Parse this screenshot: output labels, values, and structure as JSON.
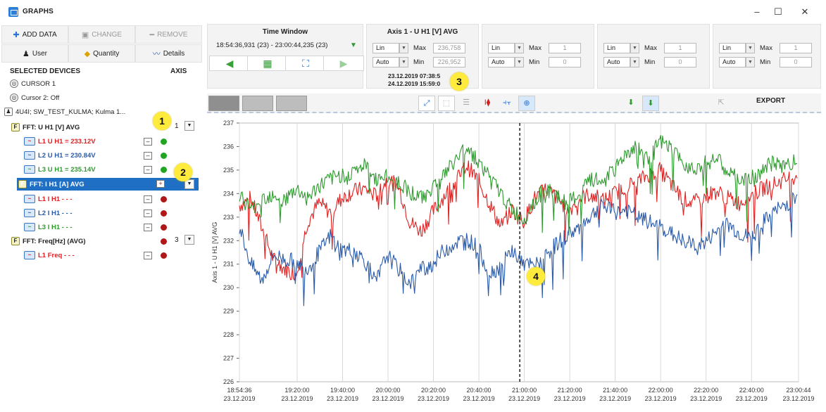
{
  "window": {
    "title": "GRAPHS",
    "minimize": "–",
    "maximize": "☐",
    "close": "✕"
  },
  "left_toolbar": {
    "add_data": "ADD DATA",
    "change": "CHANGE",
    "remove": "REMOVE",
    "user": "User",
    "quantity": "Quantity",
    "details": "Details"
  },
  "devices": {
    "header": "SELECTED DEVICES",
    "axis_header": "AXIS",
    "cursor1": "CURSOR 1",
    "cursor2": "Cursor 2: Off",
    "device": "4U4I; SW_TEST_KULMA; Kulma 1...",
    "fft_u": "FFT: U H1 [V] AVG",
    "l1_u": "L1 U H1 = 233.12V",
    "l2_u": "L2 U H1 = 230.84V",
    "l3_u": "L3 U H1 = 235.14V",
    "fft_i": "FFT: I H1 [A] AVG",
    "l1_i": "L1 I H1 - - -",
    "l2_i": "L2 I H1 - - -",
    "l3_i": "L3 I H1 - - -",
    "fft_f": "FFT: Freq[Hz] (AVG)",
    "l1_f": "L1 Freq - - -",
    "axis_u": "1",
    "axis_f": "3"
  },
  "colors": {
    "l1": "#e02020",
    "l2": "#2a5aa8",
    "l3": "#2e9a2e",
    "dot_green": "#1fa51f",
    "dot_red": "#b01818",
    "badge": "#ffeb3b"
  },
  "time_window": {
    "title": "Time Window",
    "range": "18:54:36,931 (23) - 23:00:44,235 (23)"
  },
  "axis1": {
    "title": "Axis 1 - U H1 [V] AVG",
    "scale": "Lin",
    "mode": "Auto",
    "max_label": "Max",
    "min_label": "Min",
    "max_value": "236,758",
    "min_value": "226,952",
    "date1": "23.12.2019 07:38:5",
    "date2": "24.12.2019 15:59:0"
  },
  "axis_panels": [
    {
      "scale": "Lin",
      "mode": "Auto",
      "max_label": "Max",
      "min_label": "Min",
      "max_value": "1",
      "min_value": "0"
    },
    {
      "scale": "Lin",
      "mode": "Auto",
      "max_label": "Max",
      "min_label": "Min",
      "max_value": "1",
      "min_value": "0"
    },
    {
      "scale": "Lin",
      "mode": "Auto",
      "max_label": "Max",
      "min_label": "Min",
      "max_value": "1",
      "min_value": "0"
    }
  ],
  "toolbar2": {
    "export": "EXPORT"
  },
  "badges": {
    "b1": "1",
    "b2": "2",
    "b3": "3",
    "b4": "4"
  },
  "chart_data": {
    "type": "line",
    "ylabel": "Axis 1 - U H1 [V] AVG",
    "ylim": [
      226,
      237
    ],
    "yticks": [
      "237",
      "236",
      "235",
      "234",
      "233",
      "232",
      "231",
      "230",
      "229",
      "228",
      "227",
      "226"
    ],
    "xticks": [
      {
        "time": "18:54:36",
        "date": "23.12.2019"
      },
      {
        "time": "19:20:00",
        "date": "23.12.2019"
      },
      {
        "time": "19:40:00",
        "date": "23.12.2019"
      },
      {
        "time": "20:00:00",
        "date": "23.12.2019"
      },
      {
        "time": "20:20:00",
        "date": "23.12.2019"
      },
      {
        "time": "20:40:00",
        "date": "23.12.2019"
      },
      {
        "time": "21:00:00",
        "date": "23.12.2019"
      },
      {
        "time": "21:20:00",
        "date": "23.12.2019"
      },
      {
        "time": "21:40:00",
        "date": "23.12.2019"
      },
      {
        "time": "22:00:00",
        "date": "23.12.2019"
      },
      {
        "time": "22:20:00",
        "date": "23.12.2019"
      },
      {
        "time": "22:40:00",
        "date": "23.12.2019"
      },
      {
        "time": "23:00:44",
        "date": "23.12.2019"
      }
    ],
    "x_minutes": [
      0,
      25.4,
      45.4,
      65.4,
      85.4,
      105.4,
      125.4,
      145.4,
      165.4,
      185.4,
      205.4,
      225.4,
      246.1
    ],
    "cursor_time": "20:58:00",
    "series": [
      {
        "name": "L1 U H1",
        "color": "#e02020",
        "x": [
          0,
          5,
          10,
          15,
          20,
          25,
          30,
          35,
          40,
          45,
          50,
          55,
          60,
          65,
          70,
          75,
          80,
          85,
          90,
          95,
          100,
          105,
          110,
          115,
          120,
          125,
          130,
          135,
          140,
          145,
          150,
          155,
          160,
          165,
          170,
          175,
          180,
          185,
          190,
          195,
          200,
          205,
          210,
          215,
          220,
          225,
          230,
          235,
          240,
          246
        ],
        "y": [
          233.5,
          233.8,
          232.5,
          231.2,
          230.8,
          230.6,
          232.8,
          233.6,
          233.2,
          233.8,
          234.1,
          234.2,
          233.9,
          234.6,
          234.3,
          232.8,
          232.4,
          233.2,
          233.9,
          234.5,
          235.2,
          234.6,
          233.6,
          232.6,
          233.3,
          232.8,
          233.8,
          234.2,
          233.8,
          233.3,
          233.8,
          234.0,
          233.7,
          234.0,
          234.3,
          234.5,
          234.8,
          235.0,
          234.4,
          233.8,
          233.6,
          233.9,
          234.1,
          233.8,
          233.6,
          233.9,
          234.2,
          234.4,
          234.6,
          234.8
        ]
      },
      {
        "name": "L2 U H1",
        "color": "#2a5aa8",
        "x": [
          0,
          5,
          10,
          15,
          20,
          25,
          30,
          35,
          40,
          45,
          50,
          55,
          60,
          65,
          70,
          75,
          80,
          85,
          90,
          95,
          100,
          105,
          110,
          115,
          120,
          125,
          130,
          135,
          140,
          145,
          150,
          155,
          160,
          165,
          170,
          175,
          180,
          185,
          190,
          195,
          200,
          205,
          210,
          215,
          220,
          225,
          230,
          235,
          240,
          246
        ],
        "y": [
          232.6,
          231.0,
          230.3,
          231.4,
          231.2,
          231.1,
          230.8,
          231.5,
          232.2,
          231.6,
          231.6,
          231.2,
          230.2,
          231.4,
          230.8,
          230.2,
          230.8,
          231.0,
          231.6,
          231.9,
          232.1,
          231.7,
          230.6,
          230.9,
          231.6,
          231.0,
          230.9,
          231.4,
          231.9,
          232.3,
          232.6,
          233.1,
          233.5,
          233.2,
          233.3,
          233.0,
          232.8,
          232.6,
          232.3,
          232.0,
          231.8,
          231.9,
          232.4,
          232.7,
          232.3,
          232.1,
          232.7,
          233.2,
          233.5,
          233.9
        ]
      },
      {
        "name": "L3 U H1",
        "color": "#2e9a2e",
        "x": [
          0,
          5,
          10,
          15,
          20,
          25,
          30,
          35,
          40,
          45,
          50,
          55,
          60,
          65,
          70,
          75,
          80,
          85,
          90,
          95,
          100,
          105,
          110,
          115,
          120,
          125,
          130,
          135,
          140,
          145,
          150,
          155,
          160,
          165,
          170,
          175,
          180,
          185,
          190,
          195,
          200,
          205,
          210,
          215,
          220,
          225,
          230,
          235,
          240,
          246
        ],
        "y": [
          234.0,
          233.3,
          233.8,
          234.0,
          233.7,
          234.2,
          233.8,
          234.3,
          234.6,
          234.8,
          234.9,
          235.2,
          234.6,
          234.7,
          234.5,
          234.1,
          233.8,
          234.3,
          234.8,
          235.4,
          236.0,
          235.4,
          234.7,
          234.0,
          233.3,
          232.9,
          233.7,
          234.2,
          233.8,
          233.6,
          234.0,
          234.6,
          234.5,
          235.0,
          235.7,
          236.0,
          235.4,
          236.2,
          235.9,
          235.3,
          235.1,
          235.3,
          235.5,
          234.9,
          234.6,
          234.6,
          235.0,
          235.3,
          235.2,
          235.4
        ]
      }
    ]
  }
}
